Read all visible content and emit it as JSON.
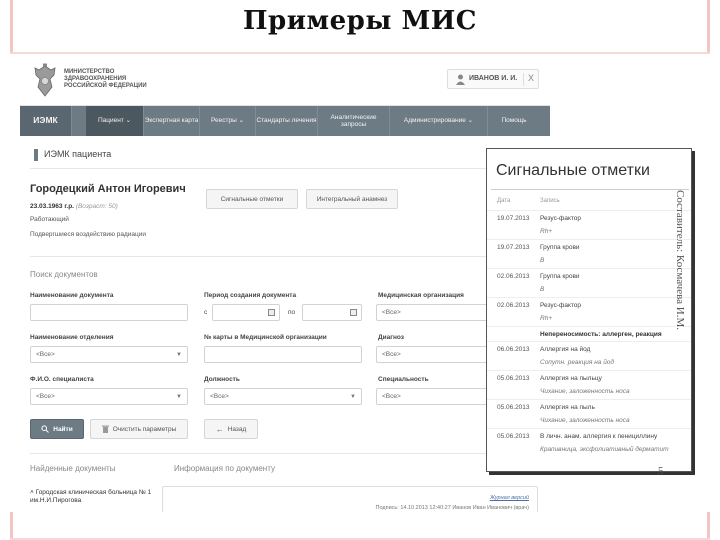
{
  "slide": {
    "title": "Примеры МИС",
    "author_vertical": "Составитель: Космачева И.М.",
    "page_number": "5"
  },
  "header": {
    "ministry": "МИНИСТЕРСТВО ЗДРАВООХРАНЕНИЯ РОССИЙСКОЙ ФЕДЕРАЦИИ",
    "user_name": "ИВАНОВ И. И.",
    "close_label": "X"
  },
  "nav": {
    "brand": "ИЭМК",
    "items": [
      {
        "label": "Пациент ⌄"
      },
      {
        "label": "Экспертная карта"
      },
      {
        "label": "Реестры ⌄"
      },
      {
        "label": "Стандарты лечения"
      },
      {
        "label": "Аналитические запросы"
      },
      {
        "label": "Администрирование ⌄"
      },
      {
        "label": "Помощь"
      }
    ]
  },
  "page": {
    "heading": "ИЭМК пациента"
  },
  "patient": {
    "name": "Городецкий Антон Игоревич",
    "dob": "23.03.1963 г.р.",
    "age": "(Возраст: 50)",
    "status": "Работающий",
    "exposure": "Подвергшиеся воздействию радиации"
  },
  "patient_buttons": {
    "signal": "Сигнальные отметки",
    "integral": "Интегральный анамнез"
  },
  "search": {
    "title": "Поиск документов",
    "doc_name_label": "Наименование документа",
    "period_label": "Период создания документа",
    "from_label": "с",
    "to_label": "по",
    "org_label": "Медицинская организация",
    "org_value": "<Все>",
    "dept_label": "Наименование отделения",
    "dept_value": "<Все>",
    "card_label": "№ карты в Медицинской организации",
    "diag_label": "Диагноз",
    "diag_value": "<Все>",
    "spec_name_label": "Ф.И.О. специалиста",
    "spec_name_value": "<Все>",
    "position_label": "Должность",
    "position_value": "<Все>",
    "specialty_label": "Специальность",
    "specialty_value": "<Все>"
  },
  "actions": {
    "find": "Найти",
    "clear": "Очистить параметры",
    "back": "Назад"
  },
  "results": {
    "found_title": "Найденные документы",
    "info_title": "Информация по документу",
    "tree_item": "Городская клиническая больница № 1 им.Н.И.Пирогова",
    "doc_link": "Журнал версий",
    "doc_line": "Подпись: 14.10.2013 12:40:27 Иванов Иван Иванович (врач)"
  },
  "signal_panel": {
    "title": "Сигнальные отметки",
    "col_date": "Дата",
    "col_record": "Запись",
    "rows": [
      {
        "date": "19.07.2013",
        "name": "Резус-фактор",
        "value": "Rh+",
        "bold": false
      },
      {
        "date": "19.07.2013",
        "name": "Группа крови",
        "value": "B",
        "bold": false
      },
      {
        "date": "02.06.2013",
        "name": "Группа крови",
        "value": "B",
        "bold": false
      },
      {
        "date": "02.06.2013",
        "name": "Резус-фактор",
        "value": "Rh+",
        "bold": false
      },
      {
        "date": "",
        "name": "Непереносимость: аллерген, реакция",
        "value": "",
        "bold": true
      },
      {
        "date": "06.06.2013",
        "name": "Аллергия на йод",
        "value": "Сопутн. реакция на йод",
        "bold": false
      },
      {
        "date": "05.06.2013",
        "name": "Аллергия на пыльцу",
        "value": "Чихание, заложенность носа",
        "bold": false
      },
      {
        "date": "05.06.2013",
        "name": "Аллергия на пыль",
        "value": "Чихание, заложенность носа",
        "bold": false
      },
      {
        "date": "05.06.2013",
        "name": "В личн. анам. аллергия к пенициллину",
        "value": "Крапивница, эксфолиативный дерматит",
        "bold": false
      }
    ]
  }
}
